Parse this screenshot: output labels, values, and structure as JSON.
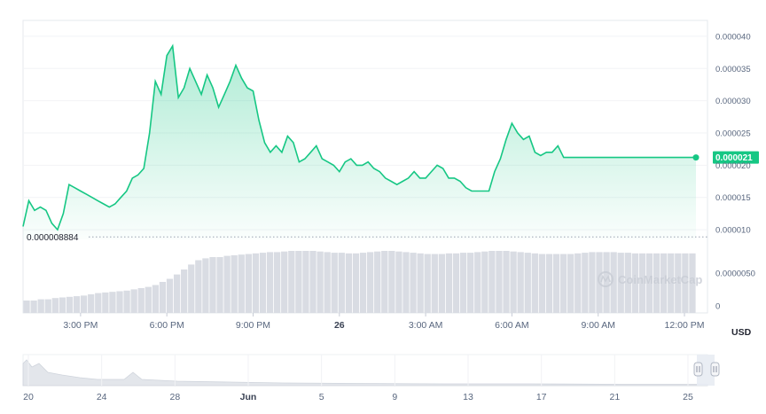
{
  "chart_data": {
    "type": "area",
    "currency": "USD",
    "y_ticks": [
      "0.000040",
      "0.000035",
      "0.000030",
      "0.000025",
      "0.000020",
      "0.000015",
      "0.000010",
      "0.0000050",
      "0"
    ],
    "y_tick_values": [
      4e-05,
      3.5e-05,
      3e-05,
      2.5e-05,
      2e-05,
      1.5e-05,
      1e-05,
      5e-06,
      0
    ],
    "ylim": [
      8.5e-06,
      4.15e-05
    ],
    "x_ticks": [
      "3:00 PM",
      "6:00 PM",
      "9:00 PM",
      "26",
      "3:00 AM",
      "6:00 AM",
      "9:00 AM",
      "12:00 PM"
    ],
    "x_tick_hours": [
      15,
      18,
      21,
      24,
      27,
      30,
      33,
      36
    ],
    "x_bold_tick": "26",
    "x_range_hours": [
      13.0,
      36.4
    ],
    "low_label": "0.000008884",
    "low_value": 8.884e-06,
    "current_label": "0.000021",
    "current_value": 2.12e-05,
    "watermark": "CoinMarketCap",
    "line_color": "#16c784",
    "x": [
      13.0,
      13.2,
      13.4,
      13.6,
      13.8,
      14.0,
      14.2,
      14.4,
      14.6,
      14.8,
      15.0,
      15.2,
      15.4,
      15.6,
      15.8,
      16.0,
      16.2,
      16.4,
      16.6,
      16.8,
      17.0,
      17.2,
      17.4,
      17.6,
      17.8,
      18.0,
      18.2,
      18.4,
      18.6,
      18.8,
      19.0,
      19.2,
      19.4,
      19.6,
      19.8,
      20.0,
      20.2,
      20.4,
      20.6,
      20.8,
      21.0,
      21.2,
      21.4,
      21.6,
      21.8,
      22.0,
      22.2,
      22.4,
      22.6,
      22.8,
      23.0,
      23.2,
      23.4,
      23.6,
      23.8,
      24.0,
      24.2,
      24.4,
      24.6,
      24.8,
      25.0,
      25.2,
      25.4,
      25.6,
      25.8,
      26.0,
      26.2,
      26.4,
      26.6,
      26.8,
      27.0,
      27.2,
      27.4,
      27.6,
      27.8,
      28.0,
      28.2,
      28.4,
      28.6,
      28.8,
      29.0,
      29.2,
      29.4,
      29.6,
      29.8,
      30.0,
      30.2,
      30.4,
      30.6,
      30.8,
      31.0,
      31.2,
      31.4,
      31.6,
      31.8,
      32.0,
      32.2,
      32.4,
      32.6,
      32.8,
      33.0,
      33.2,
      33.4,
      33.6,
      33.8,
      34.0,
      34.2,
      34.4,
      34.6,
      34.8,
      35.0,
      35.2,
      35.4,
      35.6,
      35.8,
      36.0,
      36.2,
      36.4
    ],
    "price": [
      1.05e-05,
      1.45e-05,
      1.3e-05,
      1.35e-05,
      1.3e-05,
      1.1e-05,
      1e-05,
      1.25e-05,
      1.7e-05,
      1.65e-05,
      1.6e-05,
      1.55e-05,
      1.5e-05,
      1.45e-05,
      1.4e-05,
      1.35e-05,
      1.4e-05,
      1.5e-05,
      1.6e-05,
      1.8e-05,
      1.85e-05,
      1.95e-05,
      2.5e-05,
      3.3e-05,
      3.1e-05,
      3.7e-05,
      3.85e-05,
      3.05e-05,
      3.2e-05,
      3.5e-05,
      3.3e-05,
      3.1e-05,
      3.4e-05,
      3.2e-05,
      2.9e-05,
      3.1e-05,
      3.3e-05,
      3.55e-05,
      3.35e-05,
      3.2e-05,
      3.15e-05,
      2.7e-05,
      2.35e-05,
      2.2e-05,
      2.3e-05,
      2.2e-05,
      2.45e-05,
      2.35e-05,
      2.05e-05,
      2.1e-05,
      2.2e-05,
      2.3e-05,
      2.1e-05,
      2.05e-05,
      2e-05,
      1.9e-05,
      2.05e-05,
      2.1e-05,
      2e-05,
      2e-05,
      2.05e-05,
      1.95e-05,
      1.9e-05,
      1.8e-05,
      1.75e-05,
      1.7e-05,
      1.75e-05,
      1.8e-05,
      1.9e-05,
      1.8e-05,
      1.8e-05,
      1.9e-05,
      2e-05,
      1.95e-05,
      1.8e-05,
      1.8e-05,
      1.75e-05,
      1.65e-05,
      1.6e-05,
      1.6e-05,
      1.6e-05,
      1.6e-05,
      1.9e-05,
      2.1e-05,
      2.4e-05,
      2.65e-05,
      2.5e-05,
      2.4e-05,
      2.45e-05,
      2.2e-05,
      2.15e-05,
      2.2e-05,
      2.2e-05,
      2.3e-05,
      2.12e-05,
      2.12e-05,
      2.12e-05,
      2.12e-05,
      2.12e-05,
      2.12e-05,
      2.12e-05,
      2.12e-05,
      2.12e-05,
      2.12e-05,
      2.12e-05,
      2.12e-05,
      2.12e-05,
      2.12e-05,
      2.12e-05,
      2.12e-05,
      2.12e-05,
      2.12e-05,
      2.12e-05,
      2.12e-05,
      2.12e-05,
      2.12e-05,
      2.12e-05,
      2.12e-05
    ],
    "volume_relative": [
      0.2,
      0.2,
      0.22,
      0.22,
      0.24,
      0.25,
      0.26,
      0.27,
      0.28,
      0.3,
      0.32,
      0.33,
      0.34,
      0.35,
      0.36,
      0.38,
      0.4,
      0.42,
      0.45,
      0.5,
      0.55,
      0.62,
      0.7,
      0.78,
      0.85,
      0.88,
      0.9,
      0.9,
      0.92,
      0.93,
      0.94,
      0.95,
      0.96,
      0.97,
      0.98,
      0.98,
      0.99,
      1.0,
      1.0,
      1.0,
      1.0,
      0.99,
      0.98,
      0.97,
      0.97,
      0.96,
      0.96,
      0.97,
      0.98,
      0.99,
      1.0,
      1.0,
      0.99,
      0.98,
      0.97,
      0.96,
      0.95,
      0.95,
      0.95,
      0.96,
      0.96,
      0.97,
      0.97,
      0.98,
      0.99,
      1.0,
      1.0,
      1.0,
      0.99,
      0.98,
      0.97,
      0.96,
      0.95,
      0.95,
      0.95,
      0.95,
      0.95,
      0.96,
      0.97,
      0.98,
      0.98,
      0.98,
      0.98,
      0.97,
      0.97,
      0.96,
      0.96,
      0.96,
      0.96,
      0.96,
      0.96,
      0.96,
      0.96,
      0.96
    ]
  },
  "navigator": {
    "x_ticks": [
      "20",
      "24",
      "28",
      "Jun",
      "5",
      "9",
      "13",
      "17",
      "21",
      "25"
    ],
    "bold_tick": "Jun"
  }
}
